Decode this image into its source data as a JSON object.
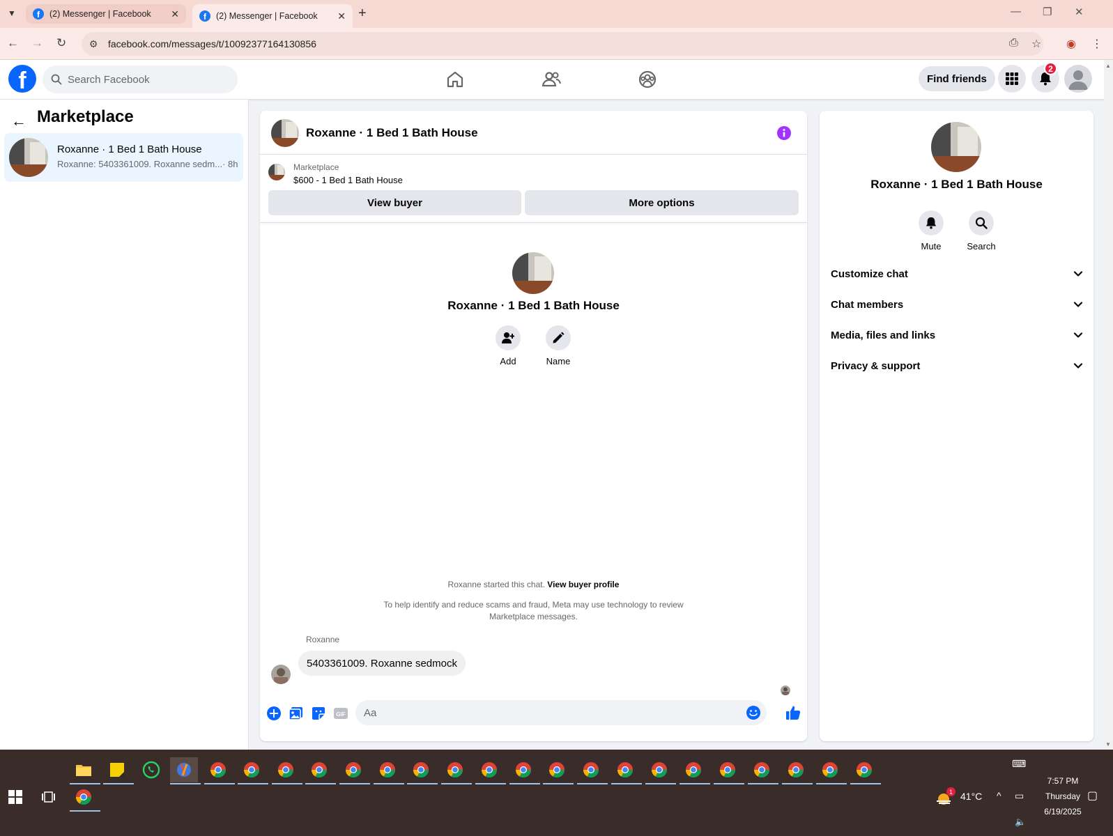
{
  "browser": {
    "tabs": [
      {
        "title": "(2) Messenger | Facebook",
        "active": false
      },
      {
        "title": "(2) Messenger | Facebook",
        "active": true
      }
    ],
    "url": "facebook.com/messages/t/10092377164130856"
  },
  "header": {
    "search_placeholder": "Search Facebook",
    "find_friends": "Find friends",
    "notifications_count": "2"
  },
  "sidebar": {
    "title": "Marketplace",
    "conversation": {
      "name": "Roxanne · 1 Bed 1 Bath House",
      "preview": "Roxanne: 5403361009. Roxanne sedm...",
      "time": "· 8h"
    }
  },
  "chat": {
    "title": "Roxanne · 1 Bed 1 Bath House",
    "marketplace_label": "Marketplace",
    "listing": "$600 - 1 Bed 1 Bath House",
    "view_buyer": "View buyer",
    "more_options": "More options",
    "center_name": "Roxanne · 1 Bed 1 Bath House",
    "add_label": "Add",
    "name_label": "Name",
    "started_text": "Roxanne started this chat.",
    "view_buyer_profile": "View buyer profile",
    "notice": "To help identify and reduce scams and fraud, Meta may use technology to review Marketplace messages.",
    "sender": "Roxanne",
    "message": "5403361009. Roxanne sedmock",
    "composer_placeholder": "Aa"
  },
  "details": {
    "name": "Roxanne · 1 Bed 1 Bath House",
    "mute": "Mute",
    "search": "Search",
    "sections": [
      "Customize chat",
      "Chat members",
      "Media, files and links",
      "Privacy & support"
    ]
  },
  "taskbar": {
    "temperature": "41°C",
    "weather_badge": "1",
    "time": "7:57 PM",
    "day": "Thursday",
    "date": "6/19/2025"
  },
  "colors": {
    "facebook_blue": "#0866ff",
    "messenger_purple": "#a033ff",
    "badge_red": "#e41e3f"
  }
}
